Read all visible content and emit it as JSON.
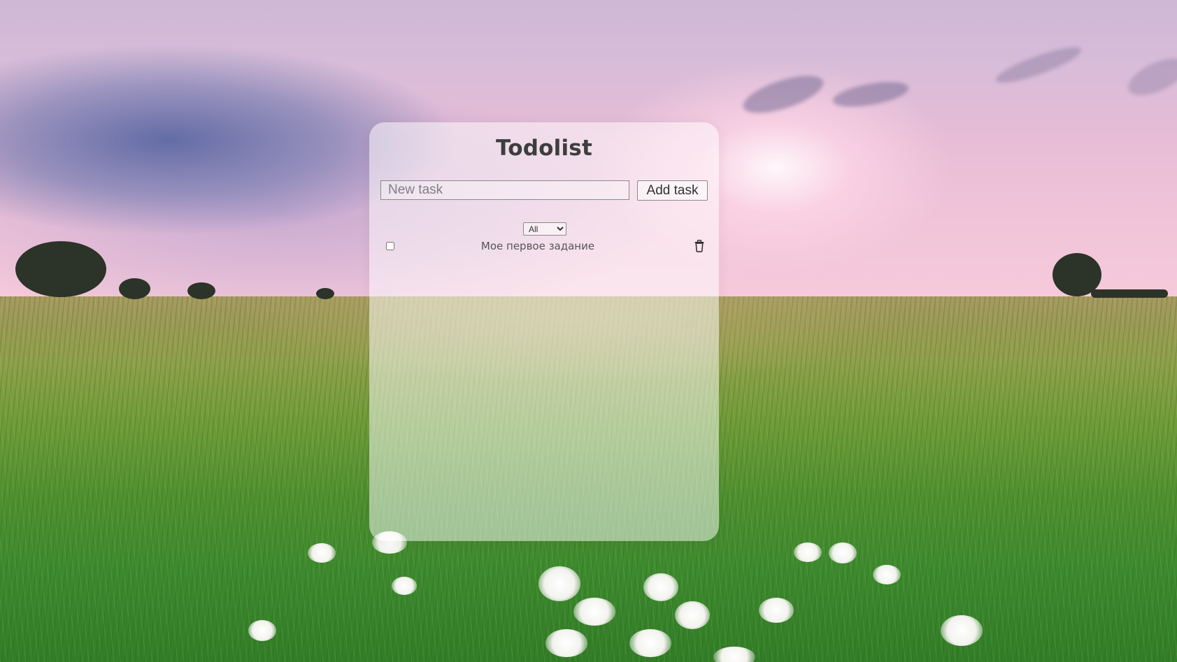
{
  "app": {
    "title": "Todolist"
  },
  "new_task": {
    "placeholder": "New task",
    "value": "",
    "add_label": "Add task"
  },
  "filter": {
    "selected": "All",
    "options": [
      "All"
    ]
  },
  "tasks": [
    {
      "text": "Мое первое задание",
      "completed": false,
      "delete_icon": "trash-icon"
    }
  ],
  "colors": {
    "title_text": "#3d3d3d",
    "task_text": "#555555",
    "card_background": "rgba(255,255,255,0.5)"
  }
}
